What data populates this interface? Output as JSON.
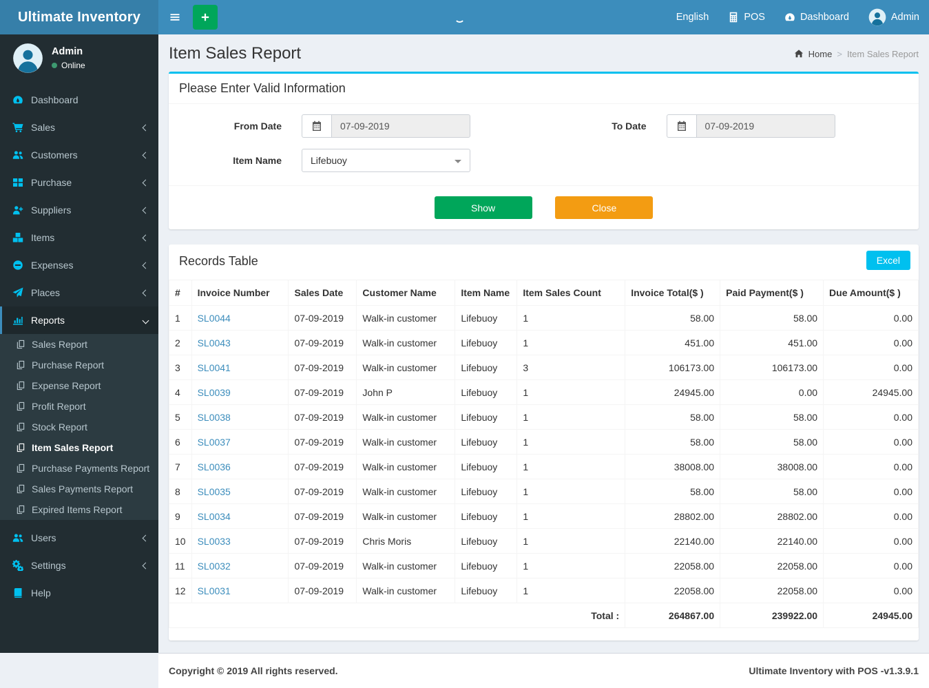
{
  "header": {
    "brand": "Ultimate Inventory",
    "nav": {
      "language": "English",
      "pos": "POS",
      "dashboard": "Dashboard",
      "user": "Admin"
    }
  },
  "sidebar": {
    "user": {
      "name": "Admin",
      "status": "Online"
    },
    "items": [
      {
        "label": "Dashboard"
      },
      {
        "label": "Sales"
      },
      {
        "label": "Customers"
      },
      {
        "label": "Purchase"
      },
      {
        "label": "Suppliers"
      },
      {
        "label": "Items"
      },
      {
        "label": "Expenses"
      },
      {
        "label": "Places"
      },
      {
        "label": "Reports"
      },
      {
        "label": "Users"
      },
      {
        "label": "Settings"
      },
      {
        "label": "Help"
      }
    ],
    "reports_submenu": [
      {
        "label": "Sales Report"
      },
      {
        "label": "Purchase Report"
      },
      {
        "label": "Expense Report"
      },
      {
        "label": "Profit Report"
      },
      {
        "label": "Stock Report"
      },
      {
        "label": "Item Sales Report",
        "active": true
      },
      {
        "label": "Purchase Payments Report"
      },
      {
        "label": "Sales Payments Report"
      },
      {
        "label": "Expired Items Report"
      }
    ]
  },
  "page": {
    "title": "Item Sales Report",
    "breadcrumb": {
      "home": "Home",
      "current": "Item Sales Report"
    }
  },
  "filter": {
    "heading": "Please Enter Valid Information",
    "from_date": {
      "label": "From Date",
      "value": "07-09-2019"
    },
    "to_date": {
      "label": "To Date",
      "value": "07-09-2019"
    },
    "item_name": {
      "label": "Item Name",
      "value": "Lifebuoy"
    },
    "show_label": "Show",
    "close_label": "Close"
  },
  "records": {
    "title": "Records Table",
    "excel_label": "Excel",
    "columns": [
      "#",
      "Invoice Number",
      "Sales Date",
      "Customer Name",
      "Item Name",
      "Item Sales Count",
      "Invoice Total($ )",
      "Paid Payment($ )",
      "Due Amount($ )"
    ],
    "rows": [
      {
        "num": "1",
        "invoice": "SL0044",
        "date": "07-09-2019",
        "customer": "Walk-in customer",
        "item": "Lifebuoy",
        "count": "1",
        "total": "58.00",
        "paid": "58.00",
        "due": "0.00"
      },
      {
        "num": "2",
        "invoice": "SL0043",
        "date": "07-09-2019",
        "customer": "Walk-in customer",
        "item": "Lifebuoy",
        "count": "1",
        "total": "451.00",
        "paid": "451.00",
        "due": "0.00"
      },
      {
        "num": "3",
        "invoice": "SL0041",
        "date": "07-09-2019",
        "customer": "Walk-in customer",
        "item": "Lifebuoy",
        "count": "3",
        "total": "106173.00",
        "paid": "106173.00",
        "due": "0.00"
      },
      {
        "num": "4",
        "invoice": "SL0039",
        "date": "07-09-2019",
        "customer": "John P",
        "item": "Lifebuoy",
        "count": "1",
        "total": "24945.00",
        "paid": "0.00",
        "due": "24945.00"
      },
      {
        "num": "5",
        "invoice": "SL0038",
        "date": "07-09-2019",
        "customer": "Walk-in customer",
        "item": "Lifebuoy",
        "count": "1",
        "total": "58.00",
        "paid": "58.00",
        "due": "0.00"
      },
      {
        "num": "6",
        "invoice": "SL0037",
        "date": "07-09-2019",
        "customer": "Walk-in customer",
        "item": "Lifebuoy",
        "count": "1",
        "total": "58.00",
        "paid": "58.00",
        "due": "0.00"
      },
      {
        "num": "7",
        "invoice": "SL0036",
        "date": "07-09-2019",
        "customer": "Walk-in customer",
        "item": "Lifebuoy",
        "count": "1",
        "total": "38008.00",
        "paid": "38008.00",
        "due": "0.00"
      },
      {
        "num": "8",
        "invoice": "SL0035",
        "date": "07-09-2019",
        "customer": "Walk-in customer",
        "item": "Lifebuoy",
        "count": "1",
        "total": "58.00",
        "paid": "58.00",
        "due": "0.00"
      },
      {
        "num": "9",
        "invoice": "SL0034",
        "date": "07-09-2019",
        "customer": "Walk-in customer",
        "item": "Lifebuoy",
        "count": "1",
        "total": "28802.00",
        "paid": "28802.00",
        "due": "0.00"
      },
      {
        "num": "10",
        "invoice": "SL0033",
        "date": "07-09-2019",
        "customer": "Chris Moris",
        "item": "Lifebuoy",
        "count": "1",
        "total": "22140.00",
        "paid": "22140.00",
        "due": "0.00"
      },
      {
        "num": "11",
        "invoice": "SL0032",
        "date": "07-09-2019",
        "customer": "Walk-in customer",
        "item": "Lifebuoy",
        "count": "1",
        "total": "22058.00",
        "paid": "22058.00",
        "due": "0.00"
      },
      {
        "num": "12",
        "invoice": "SL0031",
        "date": "07-09-2019",
        "customer": "Walk-in customer",
        "item": "Lifebuoy",
        "count": "1",
        "total": "22058.00",
        "paid": "22058.00",
        "due": "0.00"
      }
    ],
    "total": {
      "label": "Total :",
      "invoice_total": "264867.00",
      "paid_payment": "239922.00",
      "due_amount": "24945.00"
    }
  },
  "footer": {
    "left": "Copyright © 2019 All rights reserved.",
    "right": "Ultimate Inventory with POS -v1.3.9.1"
  },
  "colors": {
    "navbar": "#3c8dbc",
    "logo": "#367fa9",
    "sidebar": "#222d32",
    "accent": "#00c0ef",
    "green": "#00a65a",
    "orange": "#f39c12",
    "link": "#3c8dbc"
  }
}
